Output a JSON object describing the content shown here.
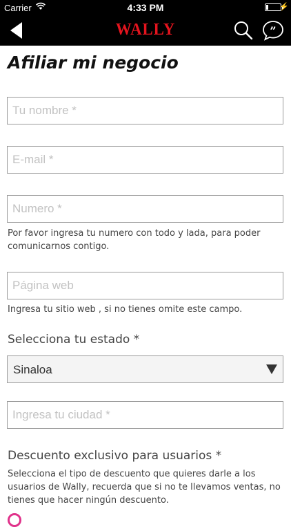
{
  "status_bar": {
    "carrier": "Carrier",
    "time": "4:33 PM",
    "bolt": "⚡"
  },
  "nav": {
    "logo": "WALLY"
  },
  "page": {
    "title": "Afiliar mi negocio"
  },
  "form": {
    "name_placeholder": "Tu nombre *",
    "email_placeholder": "E-mail *",
    "phone_placeholder": "Numero *",
    "phone_hint": "Por favor ingresa tu numero con todo y lada, para poder comunicarnos contigo.",
    "web_placeholder": "Página web",
    "web_hint": "Ingresa tu sitio web , si no tienes omite este campo.",
    "state_label": "Selecciona tu estado *",
    "state_value": "Sinaloa",
    "city_placeholder": "Ingresa tu ciudad *",
    "discount_label": "Descuento exclusivo para usuarios *",
    "discount_hint": "Selecciona el tipo de descuento que quieres darle a los usuarios de Wally, recuerda que si no te llevamos ventas, no tienes que hacer ningún descuento."
  },
  "colors": {
    "brand_red": "#e4141e",
    "radio_accent": "#e0318a"
  }
}
